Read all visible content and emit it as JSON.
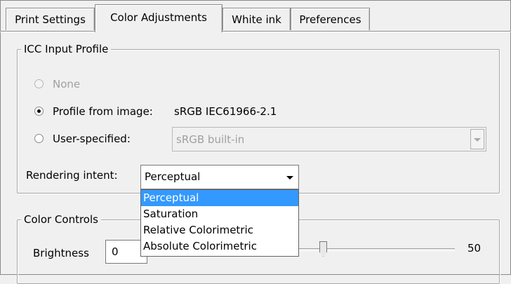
{
  "tabs": [
    {
      "label": "Print Settings"
    },
    {
      "label": "Color Adjustments"
    },
    {
      "label": "White ink"
    },
    {
      "label": "Preferences"
    }
  ],
  "active_tab": "Color Adjustments",
  "icc_profile": {
    "title": "ICC Input Profile",
    "none_label": "None",
    "from_image_label": "Profile from image:",
    "from_image_value": "sRGB IEC61966-2.1",
    "user_specified_label": "User-specified:",
    "user_specified_value": "sRGB built-in",
    "selected_option": "Profile from image:",
    "rendering_intent_label": "Rendering intent:",
    "rendering_intent_value": "Perceptual",
    "rendering_intent_options": [
      "Perceptual",
      "Saturation",
      "Relative Colorimetric",
      "Absolute Colorimetric"
    ],
    "highlighted_option": "Perceptual"
  },
  "color_controls": {
    "title": "Color Controls",
    "brightness_label": "Brightness",
    "brightness_value": "0",
    "slider_value": "50"
  },
  "colors": {
    "highlight": "#3399ff",
    "disabled_text": "#a0a0a0",
    "window_bg": "#f0f0f0"
  }
}
